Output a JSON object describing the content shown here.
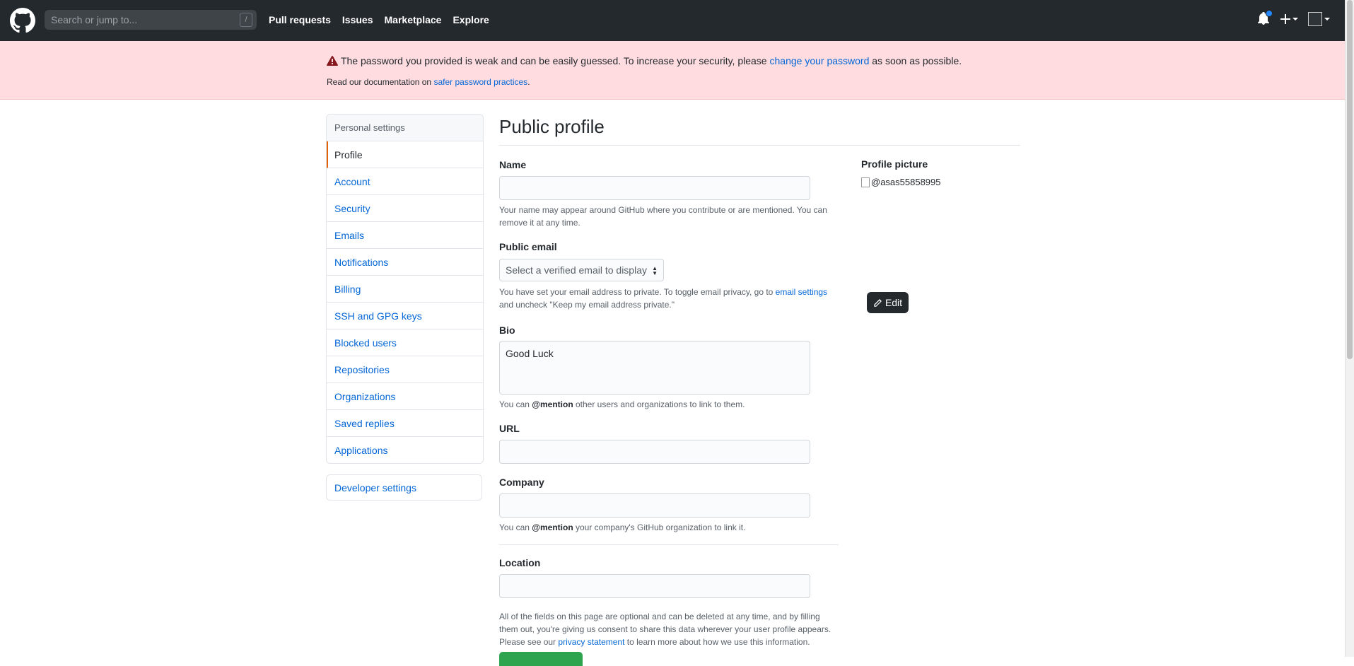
{
  "header": {
    "search_placeholder": "Search or jump to...",
    "search_shortcut": "/",
    "nav": [
      "Pull requests",
      "Issues",
      "Marketplace",
      "Explore"
    ]
  },
  "flash": {
    "line1_prefix": "The password you provided is weak and can be easily guessed. To increase your security, please",
    "line1_link": "change your password",
    "line1_suffix": "as soon as possible.",
    "line2_prefix": "Read our documentation on",
    "line2_link": "safer password practices",
    "line2_suffix": "."
  },
  "sidebar": {
    "heading": "Personal settings",
    "items": [
      "Profile",
      "Account",
      "Security",
      "Emails",
      "Notifications",
      "Billing",
      "SSH and GPG keys",
      "Blocked users",
      "Repositories",
      "Organizations",
      "Saved replies",
      "Applications"
    ],
    "selected": "Profile",
    "developer": "Developer settings"
  },
  "main": {
    "title": "Public profile",
    "name_label": "Name",
    "name_value": "",
    "name_note": "Your name may appear around GitHub where you contribute or are mentioned. You can remove it at any time.",
    "email_label": "Public email",
    "email_select": "Select a verified email to display",
    "email_note_prefix": "You have set your email address to private. To toggle email privacy, go to",
    "email_note_link": "email settings",
    "email_note_suffix": "and uncheck \"Keep my email address private.\"",
    "bio_label": "Bio",
    "bio_value": "Good Luck",
    "bio_note_prefix": "You can",
    "bio_note_mention": "@mention",
    "bio_note_suffix": "other users and organizations to link to them.",
    "url_label": "URL",
    "company_label": "Company",
    "company_note_prefix": "You can",
    "company_note_mention": "@mention",
    "company_note_suffix": "your company's GitHub organization to link it.",
    "location_label": "Location",
    "footer_note_prefix": "All of the fields on this page are optional and can be deleted at any time, and by filling them out, you're giving us consent to share this data wherever your user profile appears. Please see our",
    "footer_note_link": "privacy statement",
    "footer_note_suffix": "to learn more about how we use this information."
  },
  "profile_picture": {
    "label": "Profile picture",
    "alt": "@asas55858995",
    "edit_label": "Edit"
  },
  "colors": {
    "header_bg": "#24292e",
    "flash_bg": "#ffdce0",
    "link": "#0366d6",
    "selected_accent": "#e36209",
    "save_green": "#2ea44f"
  }
}
